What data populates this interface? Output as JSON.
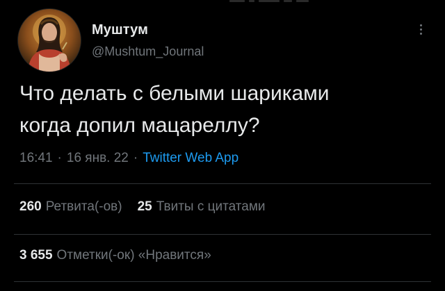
{
  "author": {
    "name": "Муштум",
    "handle": "@Mushtum_Journal"
  },
  "tweet": {
    "text_line1": "Что делать с белыми шариками",
    "text_line2": "когда допил мацареллу?",
    "time": "16:41",
    "date": "16 янв. 22",
    "separator": "·",
    "source": "Twitter Web App"
  },
  "stats": {
    "retweets_count": "260",
    "retweets_label": "Ретвита(-ов)",
    "quotes_count": "25",
    "quotes_label": "Твиты с цитатами",
    "likes_count": "3 655",
    "likes_label": "Отметки(-ок) «Нравится»"
  },
  "colors": {
    "background": "#000000",
    "text": "#e7e9ea",
    "muted": "#71767b",
    "link": "#1d9bf0",
    "divider": "#2f3336"
  },
  "icons": {
    "more": "more-vertical-icon"
  }
}
